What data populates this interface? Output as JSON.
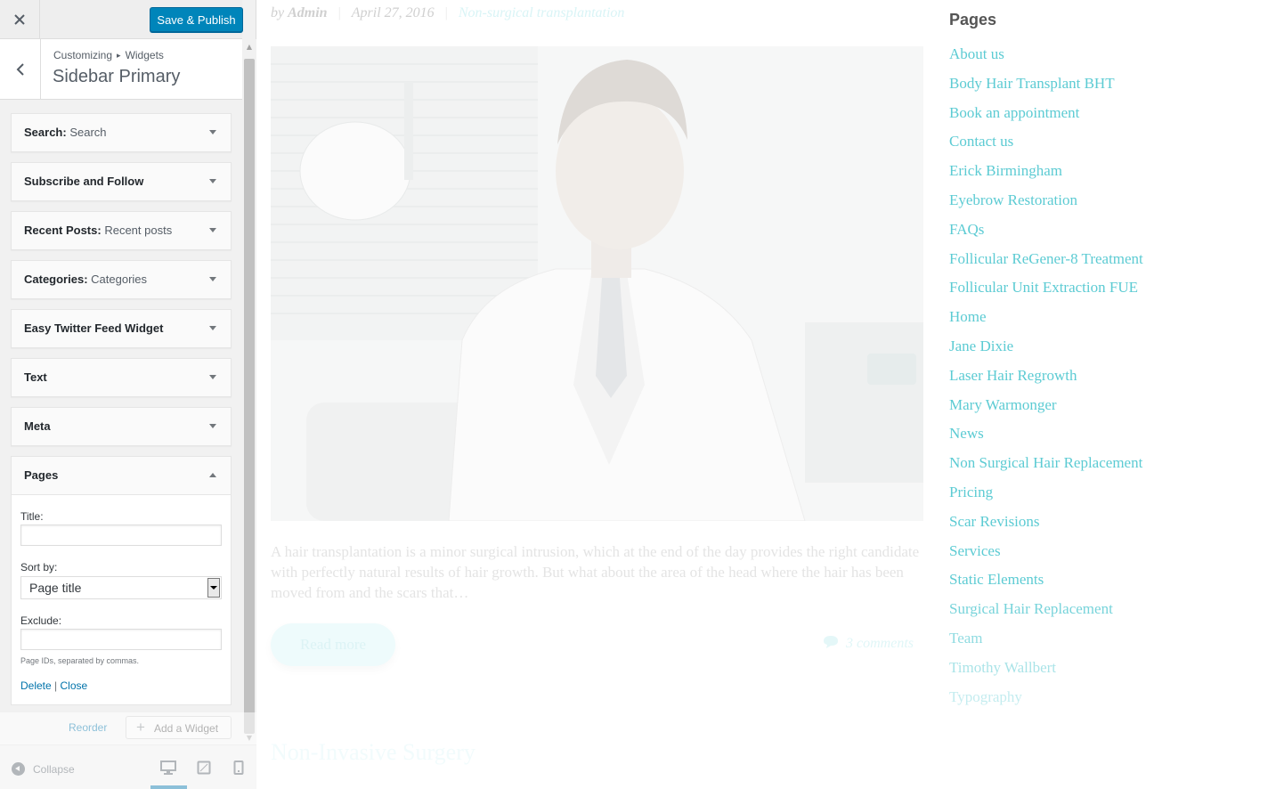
{
  "customizer": {
    "close_label": "×",
    "publish_label": "Save & Publish",
    "breadcrumb": {
      "root": "Customizing",
      "sep": "▸",
      "current": "Widgets"
    },
    "section_title": "Sidebar Primary",
    "widgets": [
      {
        "name": "Search:",
        "subtitle": "Search"
      },
      {
        "name": "Subscribe and Follow",
        "subtitle": ""
      },
      {
        "name": "Recent Posts:",
        "subtitle": "Recent posts"
      },
      {
        "name": "Categories:",
        "subtitle": "Categories"
      },
      {
        "name": "Easy Twitter Feed Widget",
        "subtitle": ""
      },
      {
        "name": "Text",
        "subtitle": ""
      },
      {
        "name": "Meta",
        "subtitle": ""
      }
    ],
    "pages_widget": {
      "name": "Pages",
      "title_label": "Title:",
      "title_value": "",
      "sort_label": "Sort by:",
      "sort_value": "Page title",
      "exclude_label": "Exclude:",
      "exclude_value": "",
      "exclude_hint": "Page IDs, separated by commas.",
      "delete_label": "Delete",
      "separator": "|",
      "close_label": "Close"
    },
    "reorder_label": "Reorder",
    "add_widget_label": "Add a Widget",
    "collapse_label": "Collapse",
    "accent_color": "#0085ba"
  },
  "preview": {
    "meta": {
      "by": "by",
      "author": "Admin",
      "date": "April 27, 2016",
      "category": "Non-surgical transplantation"
    },
    "excerpt": "A hair transplantation is a minor surgical intrusion, which at the end of the day provides the right candidate with perfectly natural results of hair growth. But what about  the area of the head where the hair has been moved from and the scars that…",
    "read_more": "Read more",
    "comments": "3 comments",
    "next_post_title": "Non-Invasive Surgery",
    "sidebar_title": "Pages",
    "link_color": "#5ccbd3",
    "pages": [
      "About us",
      "Body Hair Transplant BHT",
      "Book an appointment",
      "Contact us",
      "Erick Birmingham",
      "Eyebrow Restoration",
      "FAQs",
      "Follicular ReGener-8 Treatment",
      "Follicular Unit Extraction FUE",
      "Home",
      "Jane Dixie",
      "Laser Hair Regrowth",
      "Mary Warmonger",
      "News",
      "Non Surgical Hair Replacement",
      "Pricing",
      "Scar Revisions",
      "Services",
      "Static Elements",
      "Surgical Hair Replacement",
      "Team",
      "Timothy Wallbert",
      "Typography"
    ]
  }
}
